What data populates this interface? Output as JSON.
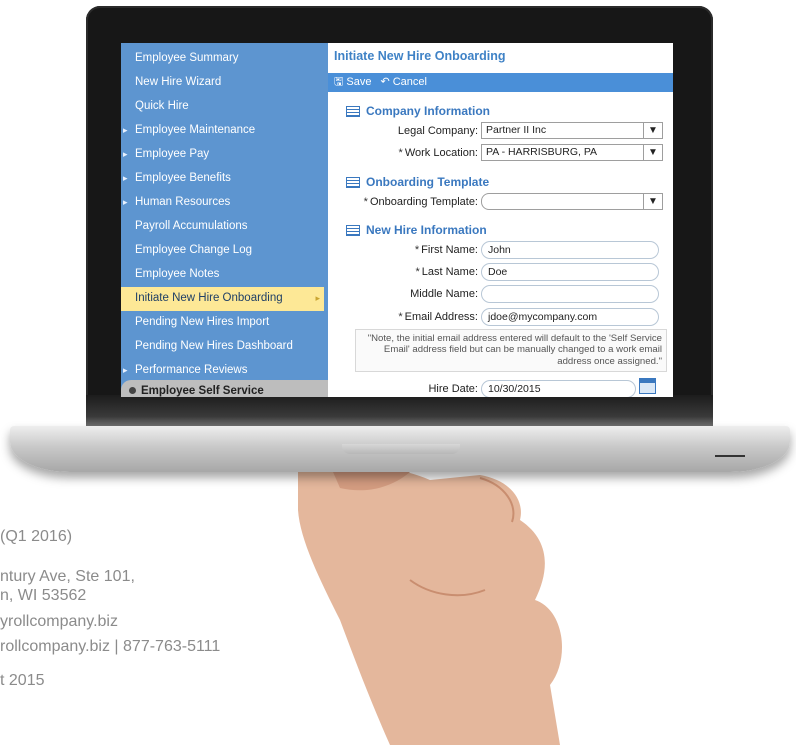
{
  "background_text": {
    "line1": "(Q1 2016)",
    "line2": "ntury Ave, Ste 101,",
    "line3": "n, WI 53562",
    "line4": "yrollcompany.biz",
    "line5": "rollcompany.biz  |  877-763-5111",
    "line6": "t 2015"
  },
  "sidebar": {
    "items": [
      {
        "label": "Employee Summary",
        "collapsible": false
      },
      {
        "label": "New Hire Wizard",
        "collapsible": false
      },
      {
        "label": "Quick Hire",
        "collapsible": false
      },
      {
        "label": "Employee Maintenance",
        "collapsible": true
      },
      {
        "label": "Employee Pay",
        "collapsible": true
      },
      {
        "label": "Employee Benefits",
        "collapsible": true
      },
      {
        "label": "Human Resources",
        "collapsible": true
      },
      {
        "label": "Payroll Accumulations",
        "collapsible": false
      },
      {
        "label": "Employee Change Log",
        "collapsible": false
      },
      {
        "label": "Employee Notes",
        "collapsible": false
      },
      {
        "label": "Initiate New Hire Onboarding",
        "collapsible": false,
        "active": true
      },
      {
        "label": "Pending New Hires Import",
        "collapsible": false
      },
      {
        "label": "Pending New Hires Dashboard",
        "collapsible": false
      },
      {
        "label": "Performance Reviews",
        "collapsible": true
      }
    ],
    "employee_self_service": "Employee Self Service"
  },
  "main": {
    "title": "Initiate New Hire Onboarding",
    "toolbar": {
      "save": "Save",
      "cancel": "Cancel"
    },
    "company_section": "Company Information",
    "legal_company_label": "Legal Company:",
    "legal_company_value": "Partner II Inc",
    "work_location_label": "Work Location:",
    "work_location_value": "PA - HARRISBURG, PA",
    "onboarding_section": "Onboarding Template",
    "onboarding_template_label": "Onboarding Template:",
    "onboarding_template_value": "",
    "newhire_section": "New Hire Information",
    "first_name_label": "First Name:",
    "first_name_value": "John",
    "last_name_label": "Last Name:",
    "last_name_value": "Doe",
    "middle_name_label": "Middle Name:",
    "middle_name_value": "",
    "email_label": "Email Address:",
    "email_value": "jdoe@mycompany.com",
    "email_note": "\"Note, the initial email address entered will default to the 'Self Service Email' address field but can be manually changed to a work email address once assigned.\"",
    "hire_date_label": "Hire Date:",
    "hire_date_value": "10/30/2015",
    "required_marker": "*"
  },
  "colors": {
    "sidebar": "#5d95d0",
    "active_item": "#fde896",
    "toolbar": "#4a8fd8",
    "section_heading": "#3a78bf"
  }
}
